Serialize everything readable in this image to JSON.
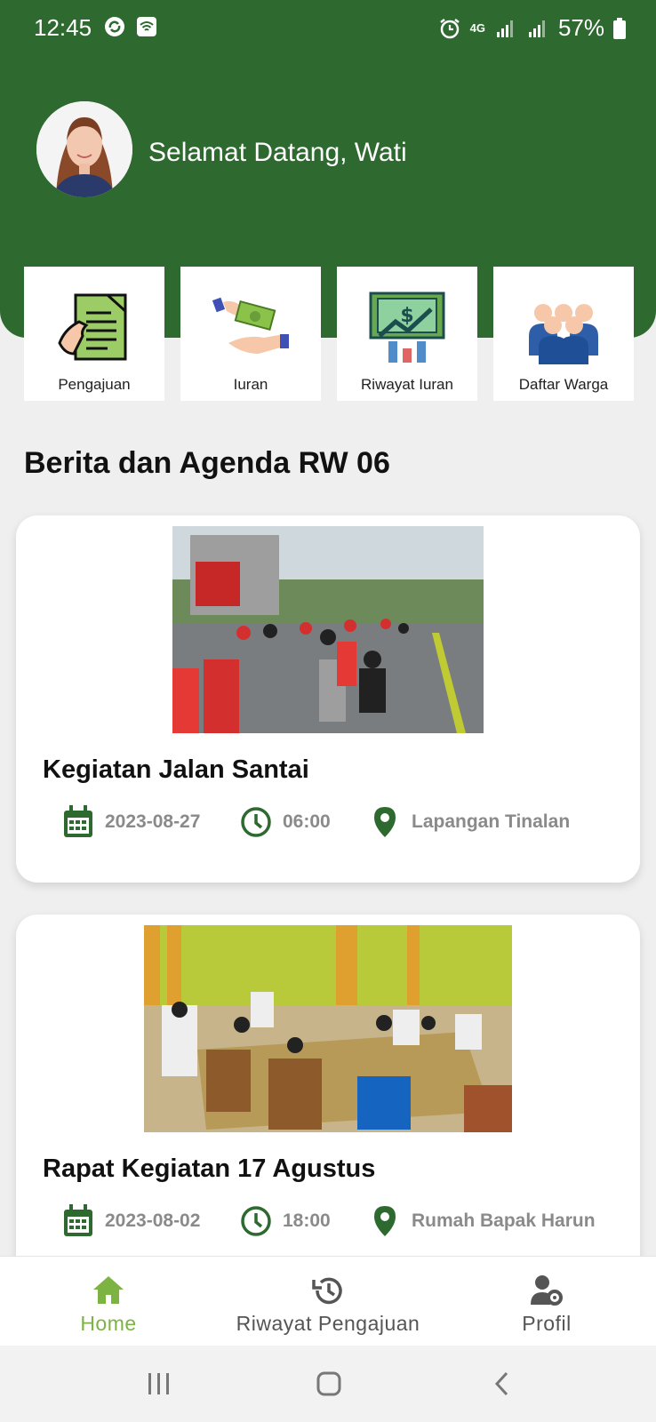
{
  "status_bar": {
    "time": "12:45",
    "battery": "57%",
    "network": "4G"
  },
  "header": {
    "welcome": "Selamat Datang, Wati",
    "background_color": "#2e6930"
  },
  "menu": {
    "items": [
      {
        "label": "Pengajuan",
        "icon": "document-hand-icon"
      },
      {
        "label": "Iuran",
        "icon": "money-hand-icon"
      },
      {
        "label": "Riwayat Iuran",
        "icon": "finance-chart-icon"
      },
      {
        "label": "Daftar Warga",
        "icon": "people-group-icon"
      }
    ]
  },
  "section": {
    "title": "Berita dan Agenda RW 06"
  },
  "news": [
    {
      "title": "Kegiatan Jalan Santai",
      "date": "2023-08-27",
      "time": "06:00",
      "location": "Lapangan Tinalan"
    },
    {
      "title": "Rapat Kegiatan 17 Agustus",
      "date": "2023-08-02",
      "time": "18:00",
      "location": "Rumah Bapak Harun"
    }
  ],
  "bottom_nav": {
    "items": [
      {
        "label": "Home",
        "icon": "home-icon",
        "active": true
      },
      {
        "label": "Riwayat Pengajuan",
        "icon": "history-icon",
        "active": false
      },
      {
        "label": "Profil",
        "icon": "user-settings-icon",
        "active": false
      }
    ],
    "active_color": "#7cb342"
  }
}
